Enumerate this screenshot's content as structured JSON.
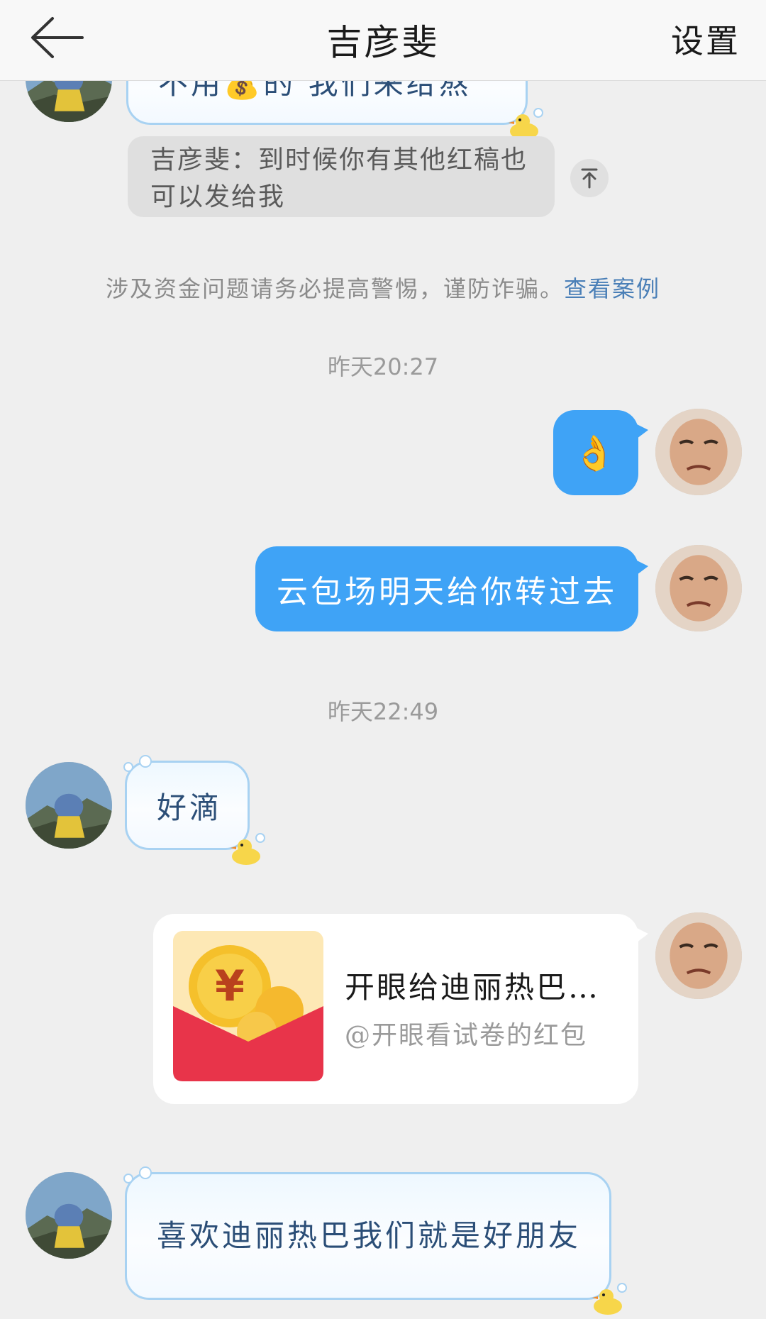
{
  "header": {
    "title": "吉彦斐",
    "settings_label": "设置"
  },
  "messages": {
    "partial_top": {
      "text": "不用💰的 我们来给熬"
    },
    "quote": {
      "text": "吉彦斐：到时候你有其他红稿也可以发给我"
    },
    "notice": {
      "text": "涉及资金问题请务必提高警惕，谨防诈骗。",
      "link_label": "查看案例"
    },
    "time_1": "昨天20:27",
    "ok_emoji": "👌",
    "sent_text": "云包场明天给你转过去",
    "time_2": "昨天22:49",
    "reply_1": "好滴",
    "red_packet": {
      "title": "开眼给迪丽热巴…",
      "subtitle": "@开眼看试卷的红包"
    },
    "reply_2": "喜欢迪丽热巴我们就是好朋友"
  },
  "colors": {
    "outgoing_bubble": "#3fa3f6",
    "incoming_bubble_border": "#a8d2f2",
    "incoming_text": "#2b4e77",
    "link": "#4a7fb7",
    "red_packet": "#e8344a"
  }
}
